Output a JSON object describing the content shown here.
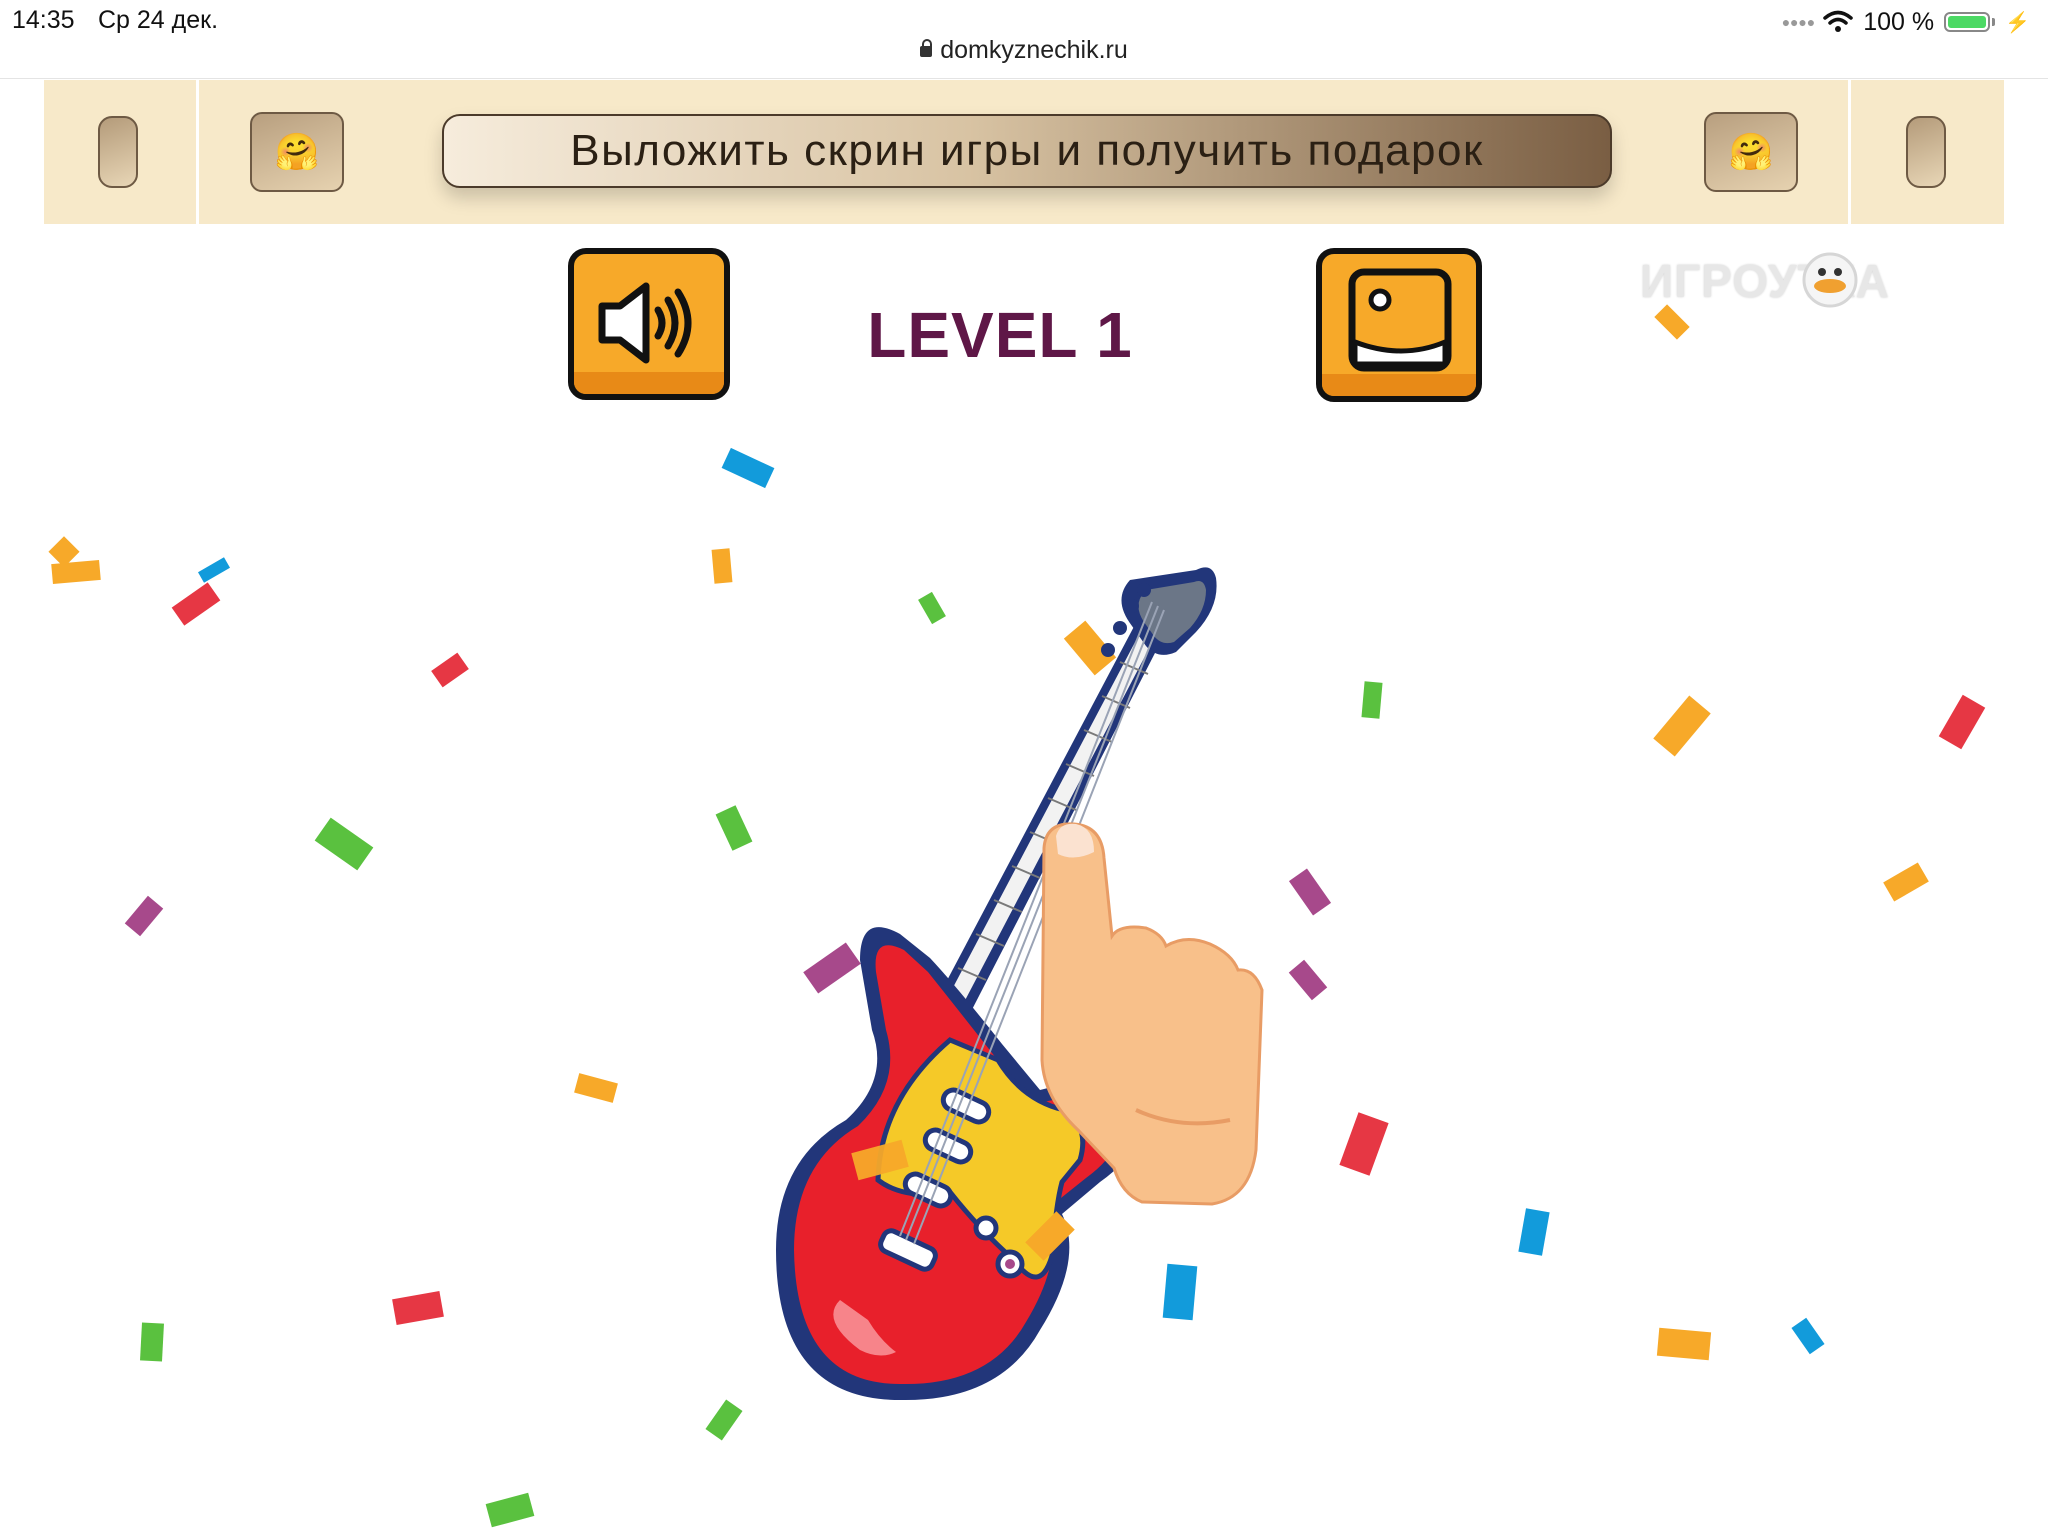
{
  "status_bar": {
    "time": "14:35",
    "date": "Ср 24 дек.",
    "url": "domkyznechik.ru",
    "battery": "100 %"
  },
  "banner": {
    "text": "Выложить скрин игры и получить подарок",
    "left_emoji": "🤗",
    "right_emoji": "🤗"
  },
  "game": {
    "level_label": "LEVEL 1",
    "sound_button_icon": "speaker-icon",
    "picture_button_icon": "picture-icon",
    "brand": "ИГРОУТКА",
    "main_image": "electric-guitar",
    "hint_icon": "pointing-hand-icon"
  },
  "colors": {
    "button_orange": "#f7a929",
    "level_text": "#5f1747",
    "guitar_body": "#e8202b",
    "banner_bg": "#f7e9c9"
  }
}
